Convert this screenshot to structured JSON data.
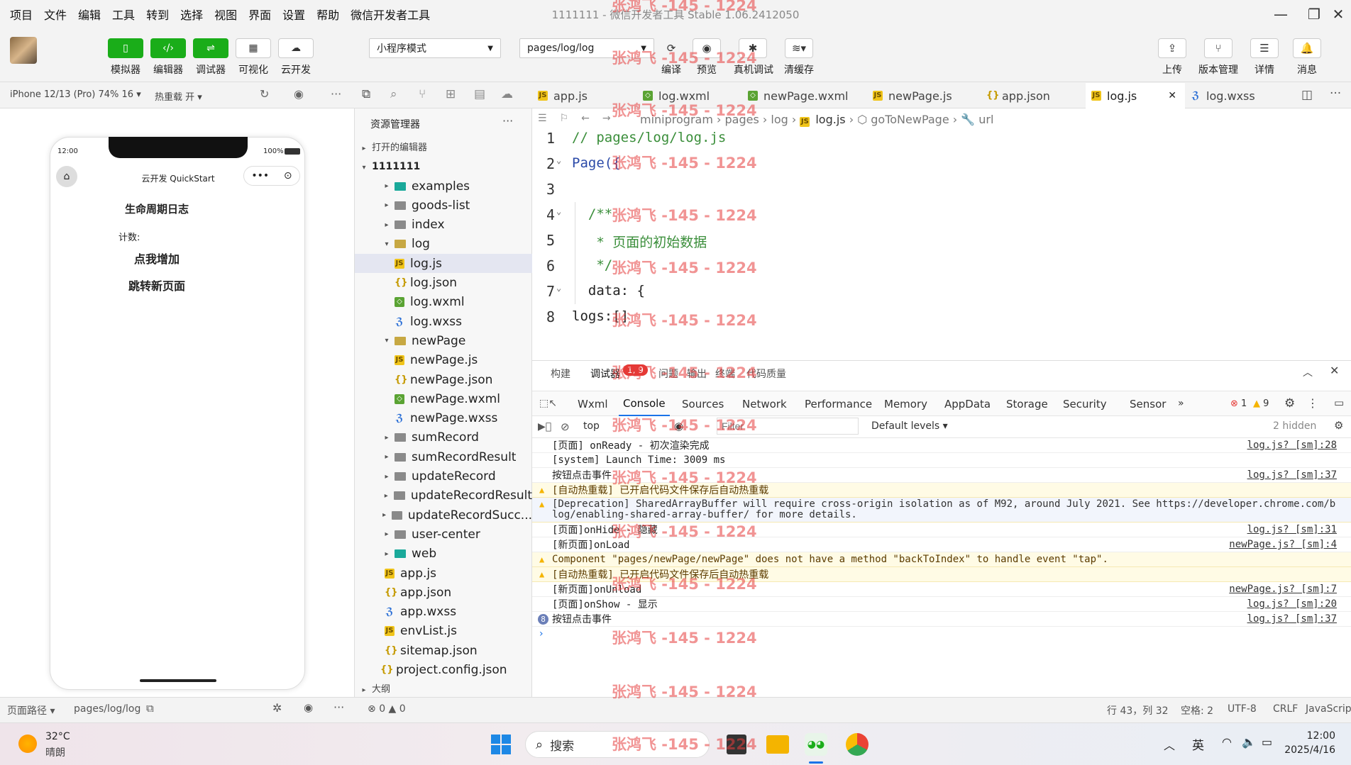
{
  "menu": [
    "项目",
    "文件",
    "编辑",
    "工具",
    "转到",
    "选择",
    "视图",
    "界面",
    "设置",
    "帮助",
    "微信开发者工具"
  ],
  "window_title": "1111111 - 微信开发者工具 Stable 1.06.2412050",
  "toolbar": {
    "simulator": "模拟器",
    "editor": "编辑器",
    "debugger": "调试器",
    "visual": "可视化",
    "cloud": "云开发",
    "mode": "小程序模式",
    "page": "pages/log/log",
    "compile": "编译",
    "preview": "预览",
    "realdebug": "真机调试",
    "clearcache": "清缓存",
    "upload": "上传",
    "version": "版本管理",
    "details": "详情",
    "messages": "消息"
  },
  "device": {
    "model": "iPhone 12/13 (Pro) 74% 16",
    "hotreload": "热重载 开"
  },
  "tabs": [
    "app.js",
    "log.wxml",
    "newPage.wxml",
    "newPage.js",
    "app.json",
    "log.js",
    "log.wxss"
  ],
  "phone": {
    "time": "12:00",
    "battery": "100%",
    "nav_title": "云开发 QuickStart",
    "page_title": "生命周期日志",
    "count_label": "计数:",
    "btn_add": "点我增加",
    "btn_jump": "跳转新页面"
  },
  "explorer": {
    "title": "资源管理器",
    "open_editors": "打开的编辑器",
    "project": "1111111",
    "outline": "大纲",
    "items": [
      {
        "name": "examples",
        "type": "folder-special",
        "depth": 2,
        "arrow": "▸"
      },
      {
        "name": "goods-list",
        "type": "folder",
        "depth": 2,
        "arrow": "▸"
      },
      {
        "name": "index",
        "type": "folder",
        "depth": 2,
        "arrow": "▸"
      },
      {
        "name": "log",
        "type": "folder-open",
        "depth": 2,
        "arrow": "▾"
      },
      {
        "name": "log.js",
        "type": "js",
        "depth": 3,
        "arrow": "",
        "selected": true
      },
      {
        "name": "log.json",
        "type": "json",
        "depth": 3,
        "arrow": ""
      },
      {
        "name": "log.wxml",
        "type": "wxml",
        "depth": 3,
        "arrow": ""
      },
      {
        "name": "log.wxss",
        "type": "wxss",
        "depth": 3,
        "arrow": ""
      },
      {
        "name": "newPage",
        "type": "folder-open",
        "depth": 2,
        "arrow": "▾"
      },
      {
        "name": "newPage.js",
        "type": "js",
        "depth": 3,
        "arrow": ""
      },
      {
        "name": "newPage.json",
        "type": "json",
        "depth": 3,
        "arrow": ""
      },
      {
        "name": "newPage.wxml",
        "type": "wxml",
        "depth": 3,
        "arrow": ""
      },
      {
        "name": "newPage.wxss",
        "type": "wxss",
        "depth": 3,
        "arrow": ""
      },
      {
        "name": "sumRecord",
        "type": "folder",
        "depth": 2,
        "arrow": "▸"
      },
      {
        "name": "sumRecordResult",
        "type": "folder",
        "depth": 2,
        "arrow": "▸"
      },
      {
        "name": "updateRecord",
        "type": "folder",
        "depth": 2,
        "arrow": "▸"
      },
      {
        "name": "updateRecordResult",
        "type": "folder",
        "depth": 2,
        "arrow": "▸"
      },
      {
        "name": "updateRecordSucc...",
        "type": "folder",
        "depth": 2,
        "arrow": "▸"
      },
      {
        "name": "user-center",
        "type": "folder",
        "depth": 2,
        "arrow": "▸"
      },
      {
        "name": "web",
        "type": "folder-special",
        "depth": 2,
        "arrow": "▸"
      },
      {
        "name": "app.js",
        "type": "js",
        "depth": 1,
        "arrow": ""
      },
      {
        "name": "app.json",
        "type": "json",
        "depth": 1,
        "arrow": ""
      },
      {
        "name": "app.wxss",
        "type": "wxss",
        "depth": 1,
        "arrow": ""
      },
      {
        "name": "envList.js",
        "type": "js",
        "depth": 1,
        "arrow": ""
      },
      {
        "name": "sitemap.json",
        "type": "json",
        "depth": 1,
        "arrow": ""
      },
      {
        "name": "project.config.json",
        "type": "json",
        "depth": 0,
        "arrow": ""
      }
    ]
  },
  "breadcrumb": [
    "miniprogram",
    "pages",
    "log",
    "log.js",
    "goToNewPage",
    "url"
  ],
  "code": [
    {
      "n": "1",
      "text": "// pages/log/log.js",
      "color": "#3a8e3a"
    },
    {
      "n": "2",
      "text": "Page({",
      "color": "#2b4aa8"
    },
    {
      "n": "3",
      "text": "",
      "color": "#222"
    },
    {
      "n": "4",
      "text": "  /**",
      "color": "#3a8e3a"
    },
    {
      "n": "5",
      "text": "   * 页面的初始数据",
      "color": "#3a8e3a"
    },
    {
      "n": "6",
      "text": "   */",
      "color": "#3a8e3a"
    },
    {
      "n": "7",
      "text": "  data: {",
      "color": "#222"
    },
    {
      "n": "8",
      "text": "logs:[]",
      "color": "#222"
    }
  ],
  "panel": {
    "tabs": [
      "构建",
      "调试器",
      "问题",
      "输出",
      "终端",
      "代码质量"
    ],
    "badge": "1, 9",
    "devtools_tabs": [
      "Wxml",
      "Console",
      "Sources",
      "Network",
      "Performance",
      "Memory",
      "AppData",
      "Storage",
      "Security",
      "Sensor"
    ],
    "errors": "1",
    "warnings": "9",
    "context": "top",
    "filter_placeholder": "Filter",
    "levels": "Default levels",
    "hidden": "2 hidden"
  },
  "logs": [
    {
      "text": "[页面] onReady - 初次渲染完成",
      "src": "log.js? [sm]:28",
      "kind": "info"
    },
    {
      "text": "[system] Launch Time: 3009 ms",
      "src": "",
      "kind": "info"
    },
    {
      "text": "按钮点击事件",
      "src": "log.js? [sm]:37",
      "kind": "info"
    },
    {
      "text": "[自动热重载] 已开启代码文件保存后自动热重载",
      "src": "",
      "kind": "warn"
    },
    {
      "text": "[Deprecation] SharedArrayBuffer will require cross-origin isolation as of M92, around July 2021. See https://developer.chrome.com/blog/enabling-shared-array-buffer/ for more details.",
      "src": "",
      "kind": "warn2"
    },
    {
      "text": "[页面]onHide - 隐藏",
      "src": "log.js? [sm]:31",
      "kind": "info"
    },
    {
      "text": "[新页面]onLoad",
      "src": "newPage.js? [sm]:4",
      "kind": "info"
    },
    {
      "text": "Component \"pages/newPage/newPage\" does not have a method \"backToIndex\" to handle event \"tap\".",
      "src": "",
      "kind": "warn"
    },
    {
      "text": "[自动热重载] 已开启代码文件保存后自动热重载",
      "src": "",
      "kind": "warn"
    },
    {
      "text": "[新页面]onUnload",
      "src": "newPage.js? [sm]:7",
      "kind": "info"
    },
    {
      "text": "[页面]onShow - 显示",
      "src": "log.js? [sm]:20",
      "kind": "info"
    },
    {
      "text": "按钮点击事件",
      "src": "log.js? [sm]:37",
      "kind": "count",
      "count": "8"
    }
  ],
  "status": {
    "path_label": "页面路径",
    "path": "pages/log/log",
    "errs": "0",
    "warns": "0",
    "position": "行 43，列 32",
    "spaces": "空格: 2",
    "encoding": "UTF-8",
    "eol": "CRLF",
    "lang": "JavaScript"
  },
  "taskbar": {
    "temp": "32°C",
    "weather": "晴朗",
    "search": "搜索",
    "ime": "英",
    "time": "12:00",
    "date": "2025/4/16"
  },
  "watermark": "张鸿飞 -145 - 1224",
  "colors": {
    "green": "#1aad19",
    "accent": "#1a73e8",
    "error": "#e53935",
    "warn": "#f5b400"
  }
}
